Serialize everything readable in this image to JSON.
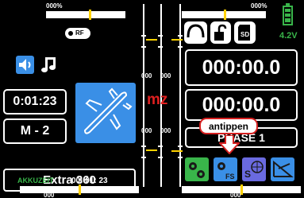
{
  "trims": {
    "top_left_pct": "000%",
    "top_right_pct": "000%",
    "mid_left_values": [
      "000",
      "000"
    ],
    "mid_right_values": [
      "000",
      "000"
    ],
    "bottom_left_value": "000",
    "bottom_right_value": "000"
  },
  "battery": {
    "voltage": "4.2V",
    "color": "#39b54a"
  },
  "icons": {
    "receiver": "rf-receiver-icon",
    "speaker": "speaker-icon",
    "music": "music-note-icon",
    "headphones": "headphones-icon",
    "lock": "lock-icon",
    "sd_card": "sd-card-icon",
    "model": "airplane-icon",
    "menu1": "gears-icon",
    "menu2": "gears-fs-icon",
    "menu3": "settings-globe-icon",
    "menu4": "telemetry-icon"
  },
  "timers": {
    "top": "000:00.0",
    "bottom": "000:00.0"
  },
  "model_time": "0:01:23",
  "model_memory": "M - 2",
  "model_name": "Extra 360",
  "mz_label": "mz",
  "phase_label": "PHASE 1",
  "callout": "antippen",
  "battery_time": {
    "label": "AKKUZEIT",
    "value": "00: 01: 23"
  },
  "colors": {
    "accent_blue": "#3a8fe6",
    "green": "#39b54a",
    "mz_red": "#e02020",
    "callout_red": "#d62020",
    "trim_yellow": "#ffd200"
  }
}
